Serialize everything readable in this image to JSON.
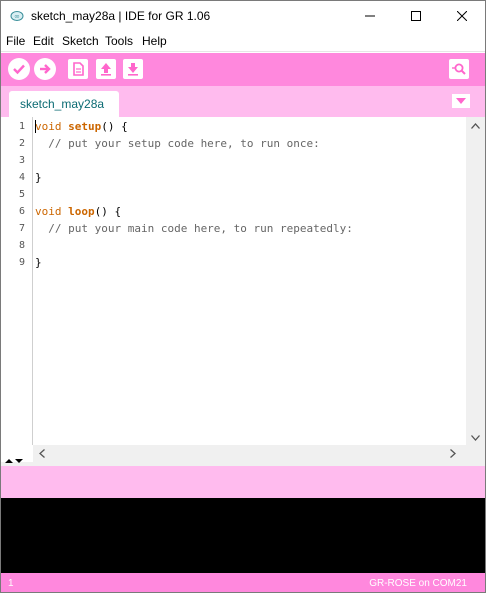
{
  "window": {
    "title": "sketch_may28a | IDE for GR 1.06"
  },
  "menu": {
    "items": [
      "File",
      "Edit",
      "Sketch",
      "Tools",
      "Help"
    ]
  },
  "toolbar": {
    "color": "#ff88dd",
    "buttons": [
      {
        "name": "verify",
        "icon": "checkmark-icon"
      },
      {
        "name": "upload",
        "icon": "arrow-right-icon"
      },
      {
        "name": "new",
        "icon": "new-file-icon"
      },
      {
        "name": "open",
        "icon": "arrow-up-icon"
      },
      {
        "name": "save",
        "icon": "arrow-down-icon"
      },
      {
        "name": "serial-monitor",
        "icon": "magnifier-icon"
      }
    ]
  },
  "tabs": {
    "active_label": "sketch_may28a",
    "strip_color": "#ffbbee"
  },
  "editor": {
    "line_numbers": [
      "1",
      "2",
      "3",
      "4",
      "5",
      "6",
      "7",
      "8",
      "9"
    ],
    "lines": [
      {
        "type": "void",
        "fn": "setup",
        "rest": "() {"
      },
      {
        "comment": "  // put your setup code here, to run once:"
      },
      {
        "plain": ""
      },
      {
        "plain": "}"
      },
      {
        "plain": ""
      },
      {
        "type": "void",
        "fn": "loop",
        "rest": "() {"
      },
      {
        "comment": "  // put your main code here, to run repeatedly:"
      },
      {
        "plain": ""
      },
      {
        "plain": "}"
      }
    ]
  },
  "status": {
    "line_number": "1",
    "board_port": "GR-ROSE on COM21"
  }
}
